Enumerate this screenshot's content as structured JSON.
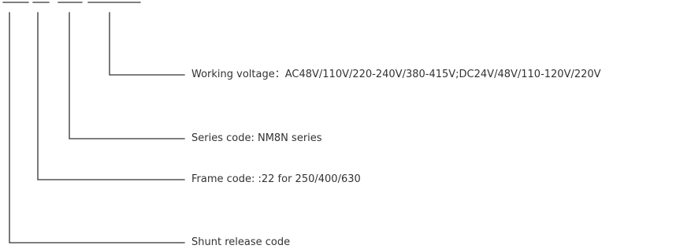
{
  "labels": {
    "working_voltage": "Working voltage：AC48V/110V/220-240V/380-415V;DC24V/48V/110-120V/220V",
    "series_code": "Series code: NM8N series",
    "frame_code": "Frame code: :22 for 250/400/630",
    "shunt_release_code": "Shunt release code"
  }
}
